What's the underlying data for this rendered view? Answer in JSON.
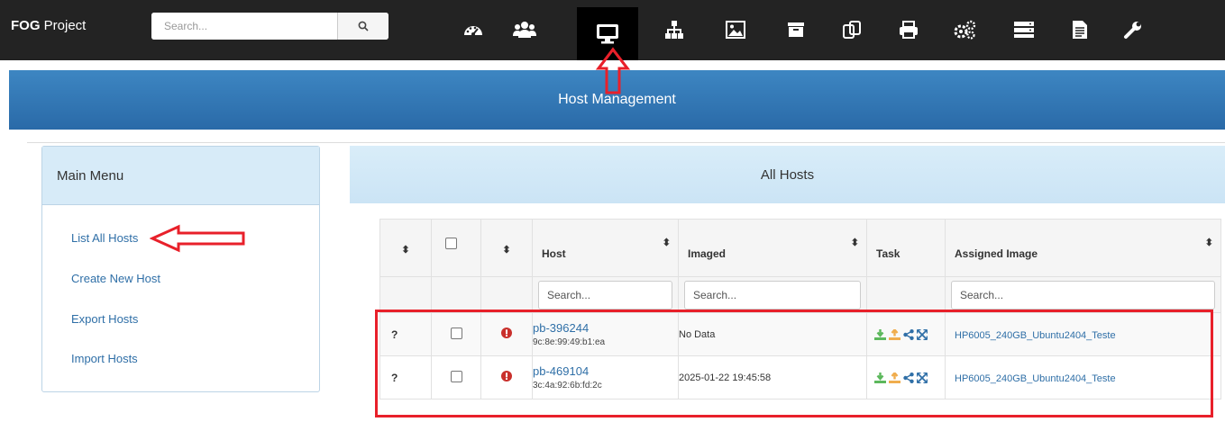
{
  "navbar": {
    "brand_bold": "FOG",
    "brand_rest": " Project",
    "search_placeholder": "Search...",
    "icons": [
      "dashboard-icon",
      "users-icon",
      "host-monitor-icon",
      "network-tree-icon",
      "image-icon",
      "storage-archive-icon",
      "snapins-icon",
      "printer-icon",
      "service-gears-icon",
      "server-icon",
      "report-icon",
      "settings-wrench-icon"
    ],
    "active_icon": "host-monitor-icon"
  },
  "banner": {
    "title": "Host Management"
  },
  "sidebar": {
    "title": "Main Menu",
    "items": [
      {
        "label": "List All Hosts"
      },
      {
        "label": "Create New Host"
      },
      {
        "label": "Export Hosts"
      },
      {
        "label": "Import Hosts"
      }
    ]
  },
  "panel": {
    "title": "All Hosts"
  },
  "table": {
    "columns": [
      {
        "label": ""
      },
      {
        "label": ""
      },
      {
        "label": ""
      },
      {
        "label": "Host"
      },
      {
        "label": "Imaged"
      },
      {
        "label": "Task"
      },
      {
        "label": "Assigned Image"
      }
    ],
    "filter_placeholder": "Search...",
    "rows": [
      {
        "flag": "?",
        "host": "pb-396244",
        "mac": "9c:8e:99:49:b1:ea",
        "imaged": "No Data",
        "image": "HP6005_240GB_Ubuntu2404_Teste"
      },
      {
        "flag": "?",
        "host": "pb-469104",
        "mac": "3c:4a:92:6b:fd:2c",
        "imaged": "2025-01-22 19:45:58",
        "image": "HP6005_240GB_Ubuntu2404_Teste"
      }
    ]
  },
  "colors": {
    "navbar_bg": "#232323",
    "banner_blue": "#2f75b5",
    "link_blue": "#2f6fa7",
    "annotation_red": "#e8202a",
    "status_error_red": "#c9302c",
    "task_green": "#5cb85c",
    "task_orange": "#f0ad4e"
  }
}
